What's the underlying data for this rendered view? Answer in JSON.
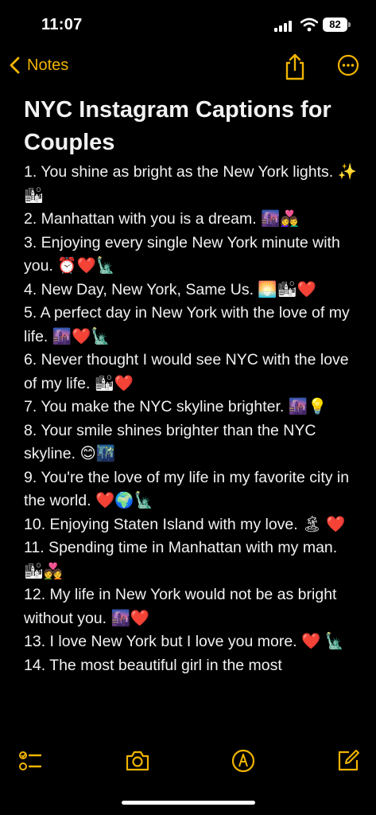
{
  "status_bar": {
    "time": "11:07",
    "battery": "82"
  },
  "nav": {
    "back_label": "Notes"
  },
  "note": {
    "title": "NYC Instagram Captions for Couples",
    "captions": [
      "1. You shine as bright as the New York lights. ✨🏙",
      "2. Manhattan with you is a dream. 🌆👩‍❤️‍👨",
      "3. Enjoying every single New York minute with you. ⏰❤️🗽",
      "4. New Day, New York, Same Us. 🌅🏙❤️",
      "5. A perfect day in New York with the love of my life. 🌆❤️🗽",
      "6. Never thought I would see NYC with the love of my life. 🏙❤️",
      "7. You make the NYC skyline brighter. 🌆💡",
      "8. Your smile shines brighter than the NYC skyline. 😊🌃",
      "9. You're the love of my life in my favorite city in the world. ❤️🌍🗽",
      "10. Enjoying Staten Island with my love. 🏝 ❤️",
      "11. Spending time in Manhattan with my man. 🏙💑",
      "12. My life in New York would not be as bright without you. 🌆❤️",
      "13. I love New York but I love you more. ❤️ 🗽",
      "14. The most beautiful girl in the most"
    ]
  },
  "colors": {
    "accent": "#f0b400",
    "background": "#000000",
    "text": "#f2f2f2"
  },
  "icons": {
    "back": "chevron-left-icon",
    "share": "share-icon",
    "more": "ellipsis-circle-icon",
    "checklist": "checklist-icon",
    "camera": "camera-icon",
    "markup": "markup-pen-icon",
    "compose": "compose-icon"
  }
}
